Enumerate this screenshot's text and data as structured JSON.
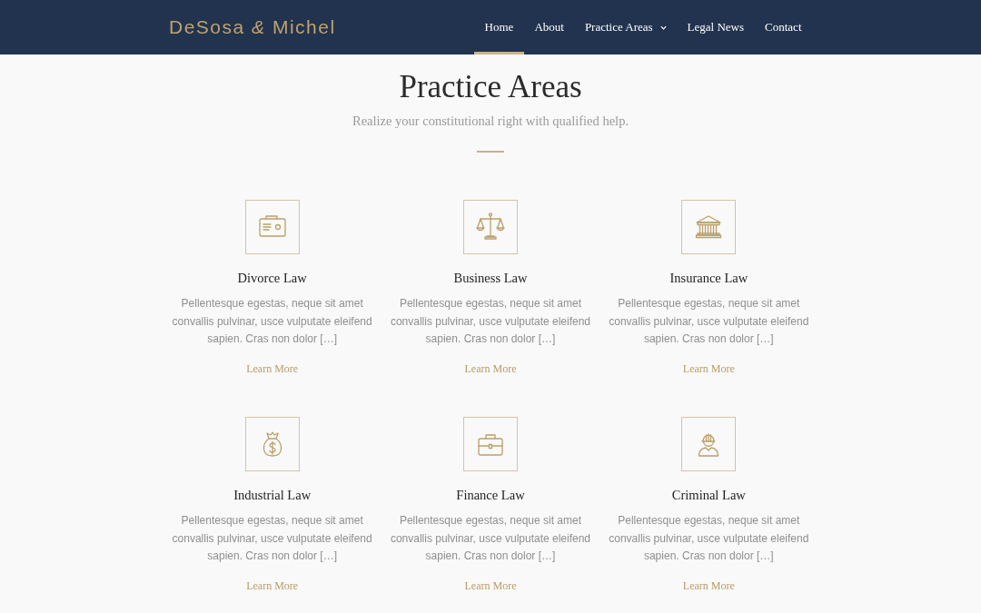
{
  "header": {
    "logo": "DeSosa *&* Michel",
    "nav": [
      {
        "label": "Home",
        "selected": true,
        "kind": "link"
      },
      {
        "label": "About",
        "selected": false,
        "kind": "link"
      },
      {
        "label": "Practice Areas",
        "selected": false,
        "kind": "dropdown"
      },
      {
        "label": "Legal News",
        "selected": false,
        "kind": "link"
      },
      {
        "label": "Contact",
        "selected": false,
        "kind": "link"
      }
    ]
  },
  "section": {
    "title": "Practice Areas",
    "subtitle": "Realize your constitutional right with qualified help."
  },
  "areas": [
    {
      "title": "Divorce Law",
      "description": "Pellentesque egestas, neque sit amet convallis pulvinar, usce vulputate eleifend sapien. Cras non dolor […]",
      "link": "Learn More"
    },
    {
      "title": "Business Law",
      "description": "Pellentesque egestas, neque sit amet convallis pulvinar, usce vulputate eleifend sapien. Cras non dolor […]",
      "link": "Learn More"
    },
    {
      "title": "Insurance Law",
      "description": "Pellentesque egestas, neque sit amet convallis pulvinar, usce vulputate eleifend sapien. Cras non dolor […]",
      "link": "Learn More"
    },
    {
      "title": "Industrial Law",
      "description": "Pellentesque egestas, neque sit amet convallis pulvinar, usce vulputate eleifend sapien. Cras non dolor […]",
      "link": "Learn More"
    },
    {
      "title": "Finance Law",
      "description": "Pellentesque egestas, neque sit amet convallis pulvinar, usce vulputate eleifend sapien. Cras non dolor […]",
      "link": "Learn More"
    },
    {
      "title": "Criminal Law",
      "description": "Pellentesque egestas, neque sit amet convallis pulvinar, usce vulputate eleifend sapien. Cras non dolor […]",
      "link": "Learn More"
    }
  ]
}
